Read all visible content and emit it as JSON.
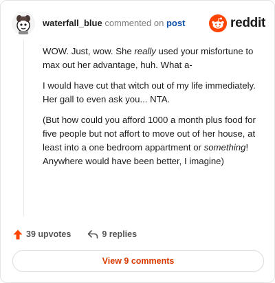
{
  "header": {
    "username": "waterfall_blue",
    "action_text": "commented on",
    "target_text": "post",
    "brand_name": "reddit"
  },
  "comment": {
    "p1_a": "WOW. Just, wow. She ",
    "p1_em": "really",
    "p1_b": " used your misfortune to max out her advantage, huh. What a-",
    "p2": "I would have cut that witch out of my life immediately. Her gall to even ask you... NTA.",
    "p3_a": "(But how could you afford 1000 a month plus food for five people but not affort to move out of her house, at least into a one bedroom appartment or ",
    "p3_em": "something",
    "p3_b": "! Anywhere would have been better, I imagine)"
  },
  "actions": {
    "upvotes_label": "39 upvotes",
    "replies_label": "9 replies"
  },
  "footer": {
    "view_comments_label": "View 9 comments"
  },
  "icons": {
    "upvote": "upvote-arrow-icon",
    "reply": "reply-arrow-icon",
    "brand": "reddit-snoo-icon",
    "avatar": "user-avatar"
  },
  "colors": {
    "accent": "#d93a00",
    "brand_orange": "#ff4500",
    "link": "#0a4fa8",
    "muted": "#7c7c7c"
  }
}
